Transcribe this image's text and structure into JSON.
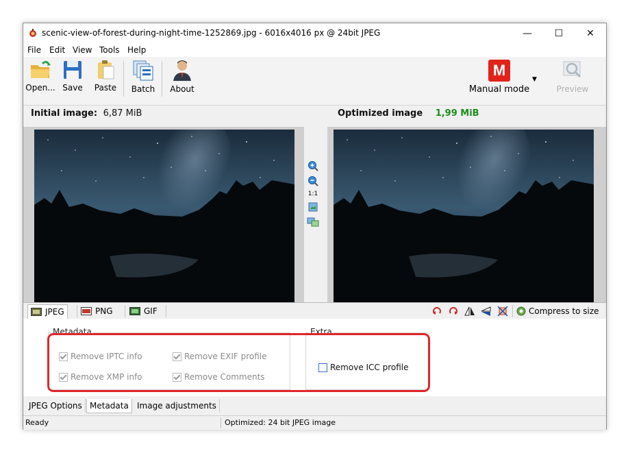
{
  "window": {
    "title": "scenic-view-of-forest-during-night-time-1252869.jpg - 6016x4016 px @ 24bit JPEG",
    "controls": {
      "minimize": "—",
      "maximize": "☐",
      "close": "✕"
    }
  },
  "menu": [
    "File",
    "Edit",
    "View",
    "Tools",
    "Help"
  ],
  "toolbar": {
    "open_label": "Open...",
    "save_label": "Save",
    "paste_label": "Paste",
    "batch_label": "Batch",
    "about_label": "About",
    "mode_label": "Manual mode",
    "mode_badge": "M",
    "preview_label": "Preview"
  },
  "initial": {
    "label": "Initial image:",
    "size": "6,87 MiB"
  },
  "optimized": {
    "label": "Optimized image",
    "size": "1,99 MiB",
    "size_color": "#1e8a1e"
  },
  "zoom": {
    "one_to_one": "1:1"
  },
  "format_tabs": [
    {
      "label": "JPEG",
      "icon": "jpeg-file-icon"
    },
    {
      "label": "PNG",
      "icon": "png-file-icon"
    },
    {
      "label": "GIF",
      "icon": "gif-file-icon"
    }
  ],
  "tools": {
    "compress_label": "Compress to size"
  },
  "metadata_group": {
    "title": "Metadata",
    "remove_iptc": "Remove IPTC info",
    "remove_exif": "Remove EXIF profile",
    "remove_xmp": "Remove XMP info",
    "remove_comments": "Remove Comments"
  },
  "extra_group": {
    "title": "Extra",
    "remove_icc": "Remove ICC profile"
  },
  "bottom_tabs": [
    "JPEG Options",
    "Metadata",
    "Image adjustments"
  ],
  "status": {
    "left": "Ready",
    "right": "Optimized: 24 bit JPEG image"
  },
  "colors": {
    "highlight": "#e0262a",
    "accent": "#2e73c6",
    "mode_red": "#e2231a"
  }
}
